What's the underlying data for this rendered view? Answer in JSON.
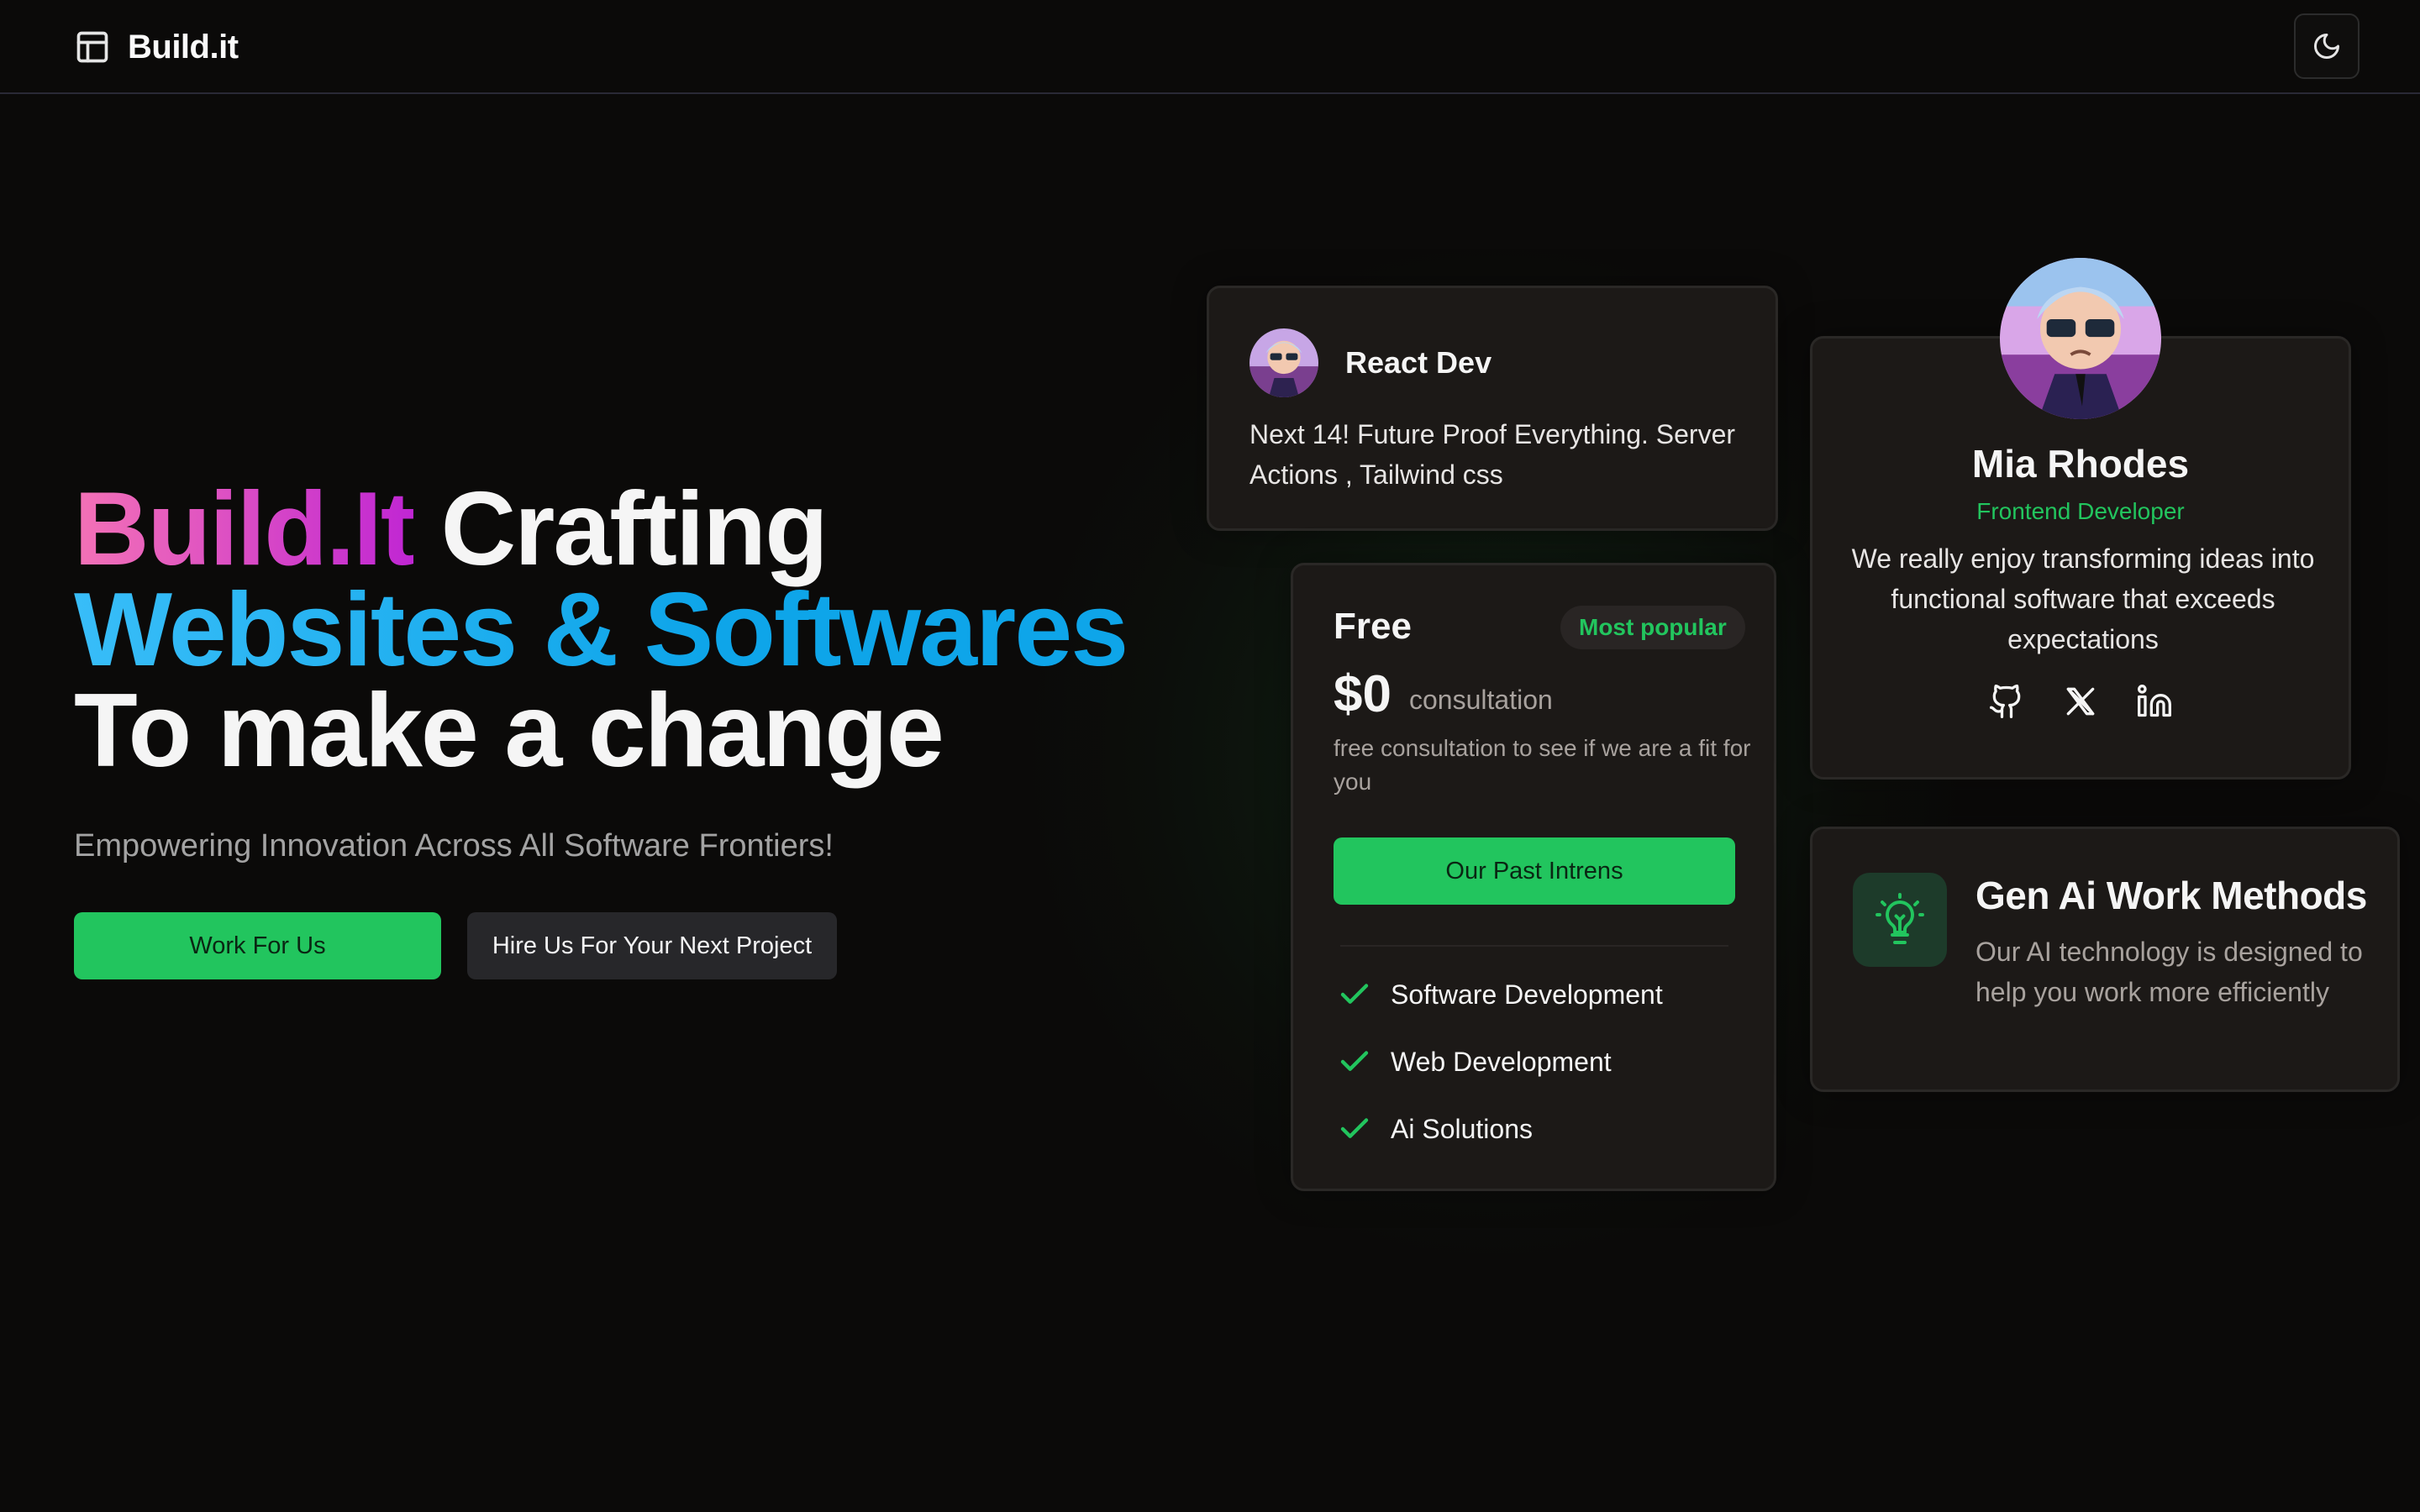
{
  "nav": {
    "brand": "Build.it",
    "brand_icon": "layout-panel-icon",
    "theme_toggle_icon": "moon-icon"
  },
  "hero": {
    "title_part1": "Build.It",
    "title_part2": " Crafting",
    "title_line2": "Websites & Softwares",
    "title_line3": "To make a change",
    "subtitle": "Empowering Innovation Across All Software Frontiers!",
    "primary_cta": "Work For Us",
    "secondary_cta": "Hire Us For Your Next Project"
  },
  "react_card": {
    "title": "React Dev",
    "body": "Next 14! Future Proof Everything. Server Actions , Tailwind css"
  },
  "pricing_card": {
    "plan": "Free",
    "badge": "Most popular",
    "price": "$0",
    "unit": "consultation",
    "description": "free consultation to see if we are a fit for you",
    "button": "Our Past Intrens",
    "features": [
      "Software Development",
      "Web Development",
      "Ai Solutions"
    ]
  },
  "profile_card": {
    "name": "Mia Rhodes",
    "role": "Frontend Developer",
    "bio": "We really enjoy transforming ideas into functional software that exceeds expectations",
    "socials": [
      "github-icon",
      "x-icon",
      "linkedin-icon"
    ]
  },
  "ai_card": {
    "title": "Gen Ai Work Methods",
    "body": "Our AI technology is designed to help you work more efficiently",
    "icon": "lightbulb-icon"
  },
  "colors": {
    "accent_green": "#22c55e",
    "background": "#0b0a09",
    "card": "#1c1917",
    "pink_gradient_start": "#f472b6",
    "blue_gradient_start": "#38bdf8"
  }
}
